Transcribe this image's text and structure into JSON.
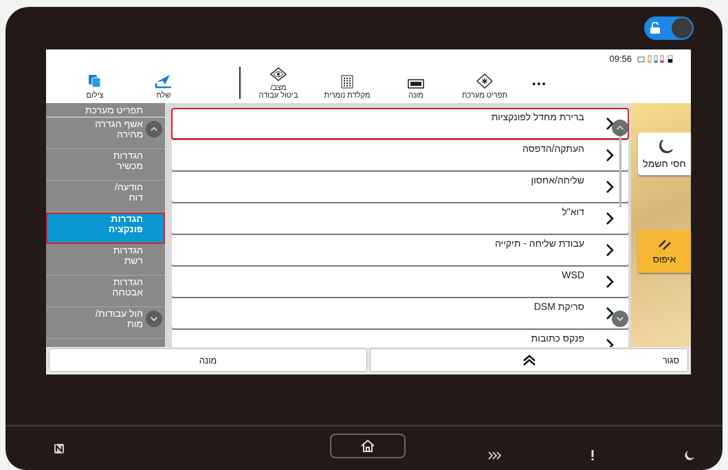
{
  "lock_toggle": {
    "on": true
  },
  "status": {
    "time": "09:56"
  },
  "top_bar": {
    "more": "•••",
    "right": [
      {
        "kind": "system_menu",
        "label": "תפריט מערכת"
      },
      {
        "kind": "counter",
        "label": "מונה"
      },
      {
        "kind": "keypad",
        "label": "מקלדת נומרית"
      },
      {
        "kind": "status",
        "label": "מצב/\nביטול עבודה"
      }
    ],
    "left": [
      {
        "kind": "send",
        "label": "שלח"
      },
      {
        "kind": "copy",
        "label": "צילום"
      }
    ]
  },
  "sidebar": {
    "title": "תפריט מערכת",
    "items": [
      {
        "label": "אשף הגדרה\nמהירה",
        "selected": false,
        "highlighted": false
      },
      {
        "label": "הגדרות\nמכשיר",
        "selected": false,
        "highlighted": false
      },
      {
        "label": "הודעה/\nדוח",
        "selected": false,
        "highlighted": false
      },
      {
        "label": "הגדרות\nפונקציה",
        "selected": true,
        "highlighted": true
      },
      {
        "label": "הגדרות\nרשת",
        "selected": false,
        "highlighted": false
      },
      {
        "label": "הגדרות\nאבטחה",
        "selected": false,
        "highlighted": false
      },
      {
        "label": "הול עבודות/\nמות",
        "selected": false,
        "highlighted": false
      }
    ]
  },
  "list": [
    {
      "label": "ברירת מחדל לפונקציות",
      "highlighted": true
    },
    {
      "label": "העתקה/הדפסה",
      "highlighted": false
    },
    {
      "label": "שליחה/אחסון",
      "highlighted": false
    },
    {
      "label": "דוא\"ל",
      "highlighted": false
    },
    {
      "label": "עבודת שליחה - תיקייה",
      "highlighted": false
    },
    {
      "label": "WSD",
      "highlighted": false
    },
    {
      "label": "סריקת DSM",
      "highlighted": false
    },
    {
      "label": "פנקס כתובות",
      "highlighted": false
    }
  ],
  "side_buttons": [
    {
      "kind": "sleep",
      "label": "חסי חשמל"
    },
    {
      "kind": "reset",
      "label": "איפוס"
    }
  ],
  "bottom_bar": {
    "left": "מונה",
    "right": "סגור"
  }
}
